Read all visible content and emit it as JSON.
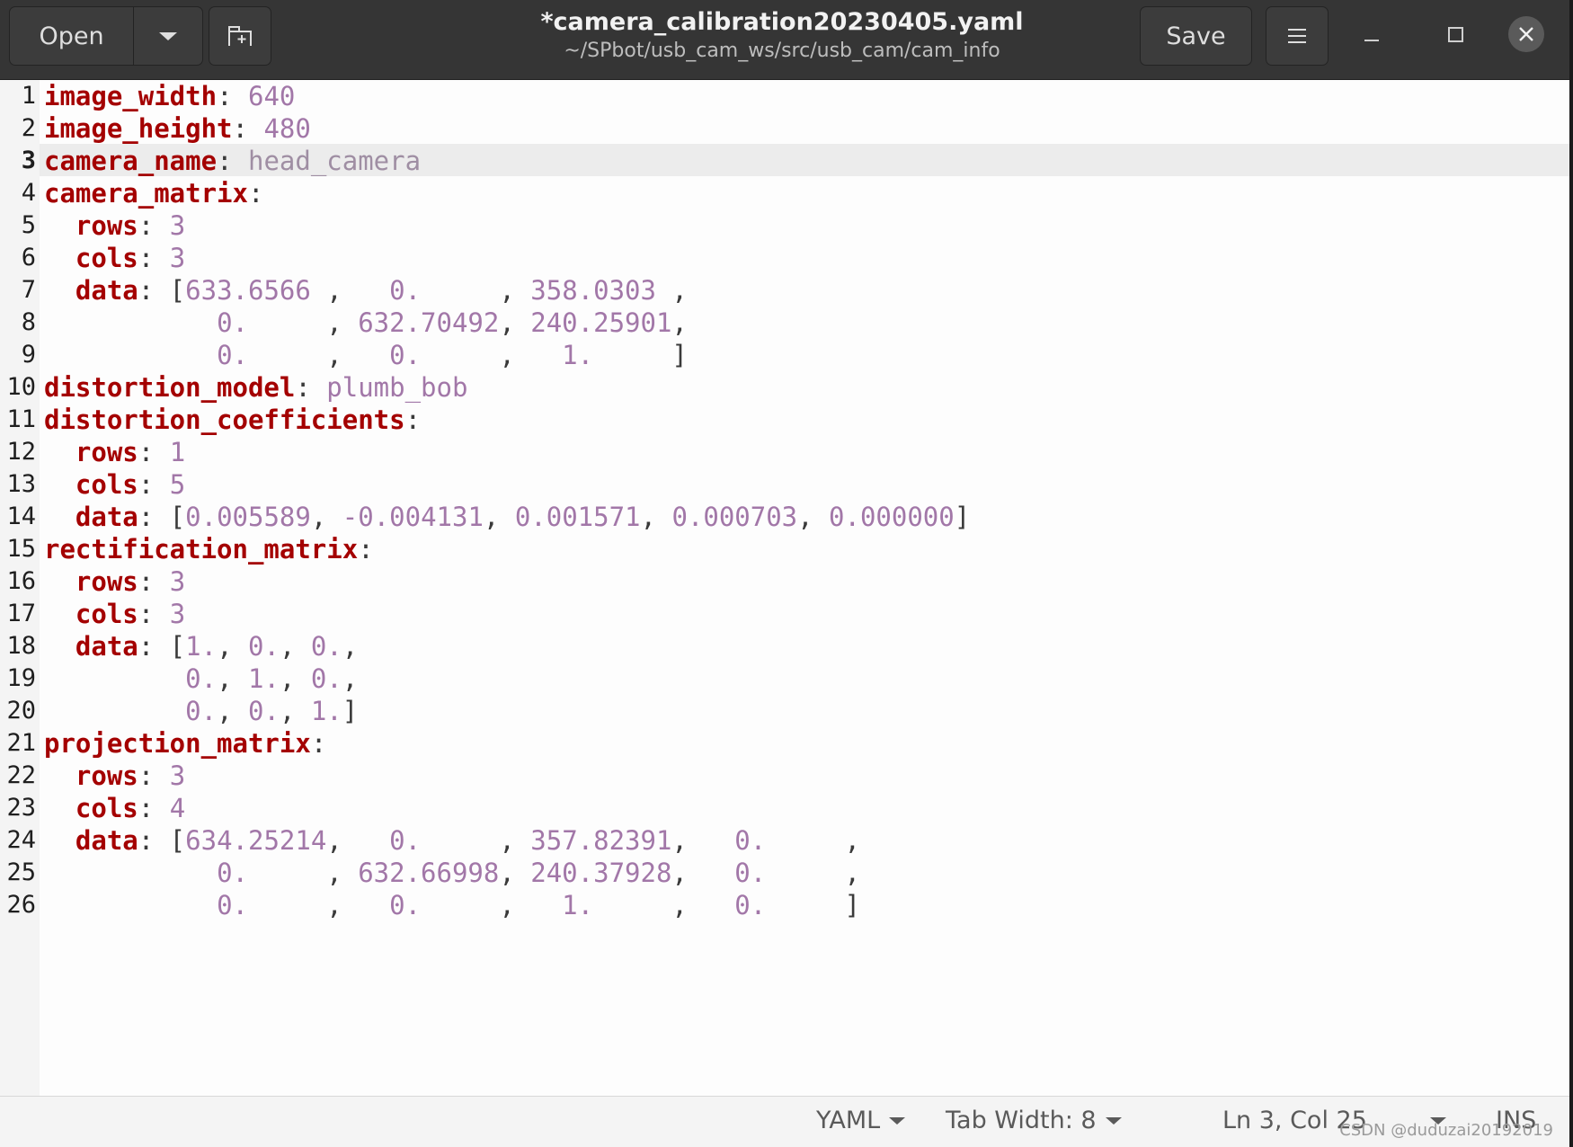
{
  "header": {
    "open_label": "Open",
    "save_label": "Save",
    "title": "*camera_calibration20230405.yaml",
    "subtitle": "~/SPbot/usb_cam_ws/src/usb_cam/cam_info"
  },
  "editor": {
    "current_line": 3,
    "lines": [
      [
        [
          "k",
          "image_width"
        ],
        [
          "p",
          ": "
        ],
        [
          "v",
          "640"
        ]
      ],
      [
        [
          "k",
          "image_height"
        ],
        [
          "p",
          ": "
        ],
        [
          "v",
          "480"
        ]
      ],
      [
        [
          "k",
          "camera_name"
        ],
        [
          "p",
          ": "
        ],
        [
          "vcur",
          "head_camera"
        ]
      ],
      [
        [
          "k",
          "camera_matrix"
        ],
        [
          "p",
          ":"
        ]
      ],
      [
        [
          "p",
          "  "
        ],
        [
          "k",
          "rows"
        ],
        [
          "p",
          ": "
        ],
        [
          "v",
          "3"
        ]
      ],
      [
        [
          "p",
          "  "
        ],
        [
          "k",
          "cols"
        ],
        [
          "p",
          ": "
        ],
        [
          "v",
          "3"
        ]
      ],
      [
        [
          "p",
          "  "
        ],
        [
          "k",
          "data"
        ],
        [
          "p",
          ": ["
        ],
        [
          "v",
          "633.6566 "
        ],
        [
          "p",
          ", "
        ],
        [
          "v",
          "  0.     "
        ],
        [
          "p",
          ", "
        ],
        [
          "v",
          "358.0303 "
        ],
        [
          "p",
          ","
        ]
      ],
      [
        [
          "p",
          "           "
        ],
        [
          "v",
          "0.     "
        ],
        [
          "p",
          ", "
        ],
        [
          "v",
          "632.70492"
        ],
        [
          "p",
          ", "
        ],
        [
          "v",
          "240.25901"
        ],
        [
          "p",
          ","
        ]
      ],
      [
        [
          "p",
          "           "
        ],
        [
          "v",
          "0.     "
        ],
        [
          "p",
          ", "
        ],
        [
          "v",
          "  0.     "
        ],
        [
          "p",
          ", "
        ],
        [
          "v",
          "  1.     "
        ],
        [
          "p",
          "]"
        ]
      ],
      [
        [
          "k",
          "distortion_model"
        ],
        [
          "p",
          ": "
        ],
        [
          "v",
          "plumb_bob"
        ]
      ],
      [
        [
          "k",
          "distortion_coefficients"
        ],
        [
          "p",
          ":"
        ]
      ],
      [
        [
          "p",
          "  "
        ],
        [
          "k",
          "rows"
        ],
        [
          "p",
          ": "
        ],
        [
          "v",
          "1"
        ]
      ],
      [
        [
          "p",
          "  "
        ],
        [
          "k",
          "cols"
        ],
        [
          "p",
          ": "
        ],
        [
          "v",
          "5"
        ]
      ],
      [
        [
          "p",
          "  "
        ],
        [
          "k",
          "data"
        ],
        [
          "p",
          ": ["
        ],
        [
          "v",
          "0.005589"
        ],
        [
          "p",
          ", "
        ],
        [
          "v",
          "-0.004131"
        ],
        [
          "p",
          ", "
        ],
        [
          "v",
          "0.001571"
        ],
        [
          "p",
          ", "
        ],
        [
          "v",
          "0.000703"
        ],
        [
          "p",
          ", "
        ],
        [
          "v",
          "0.000000"
        ],
        [
          "p",
          "]"
        ]
      ],
      [
        [
          "k",
          "rectification_matrix"
        ],
        [
          "p",
          ":"
        ]
      ],
      [
        [
          "p",
          "  "
        ],
        [
          "k",
          "rows"
        ],
        [
          "p",
          ": "
        ],
        [
          "v",
          "3"
        ]
      ],
      [
        [
          "p",
          "  "
        ],
        [
          "k",
          "cols"
        ],
        [
          "p",
          ": "
        ],
        [
          "v",
          "3"
        ]
      ],
      [
        [
          "p",
          "  "
        ],
        [
          "k",
          "data"
        ],
        [
          "p",
          ": ["
        ],
        [
          "v",
          "1."
        ],
        [
          "p",
          ", "
        ],
        [
          "v",
          "0."
        ],
        [
          "p",
          ", "
        ],
        [
          "v",
          "0."
        ],
        [
          "p",
          ","
        ]
      ],
      [
        [
          "p",
          "         "
        ],
        [
          "v",
          "0."
        ],
        [
          "p",
          ", "
        ],
        [
          "v",
          "1."
        ],
        [
          "p",
          ", "
        ],
        [
          "v",
          "0."
        ],
        [
          "p",
          ","
        ]
      ],
      [
        [
          "p",
          "         "
        ],
        [
          "v",
          "0."
        ],
        [
          "p",
          ", "
        ],
        [
          "v",
          "0."
        ],
        [
          "p",
          ", "
        ],
        [
          "v",
          "1."
        ],
        [
          "p",
          "]"
        ]
      ],
      [
        [
          "k",
          "projection_matrix"
        ],
        [
          "p",
          ":"
        ]
      ],
      [
        [
          "p",
          "  "
        ],
        [
          "k",
          "rows"
        ],
        [
          "p",
          ": "
        ],
        [
          "v",
          "3"
        ]
      ],
      [
        [
          "p",
          "  "
        ],
        [
          "k",
          "cols"
        ],
        [
          "p",
          ": "
        ],
        [
          "v",
          "4"
        ]
      ],
      [
        [
          "p",
          "  "
        ],
        [
          "k",
          "data"
        ],
        [
          "p",
          ": ["
        ],
        [
          "v",
          "634.25214"
        ],
        [
          "p",
          ", "
        ],
        [
          "v",
          "  0.     "
        ],
        [
          "p",
          ", "
        ],
        [
          "v",
          "357.82391"
        ],
        [
          "p",
          ", "
        ],
        [
          "v",
          "  0.     "
        ],
        [
          "p",
          ","
        ]
      ],
      [
        [
          "p",
          "           "
        ],
        [
          "v",
          "0.     "
        ],
        [
          "p",
          ", "
        ],
        [
          "v",
          "632.66998"
        ],
        [
          "p",
          ", "
        ],
        [
          "v",
          "240.37928"
        ],
        [
          "p",
          ", "
        ],
        [
          "v",
          "  0.     "
        ],
        [
          "p",
          ","
        ]
      ],
      [
        [
          "p",
          "           "
        ],
        [
          "v",
          "0.     "
        ],
        [
          "p",
          ", "
        ],
        [
          "v",
          "  0.     "
        ],
        [
          "p",
          ", "
        ],
        [
          "v",
          "  1.     "
        ],
        [
          "p",
          ", "
        ],
        [
          "v",
          "  0.     "
        ],
        [
          "p",
          "]"
        ]
      ]
    ]
  },
  "statusbar": {
    "language": "YAML",
    "tab_width": "Tab Width: 8",
    "position": "Ln 3, Col 25",
    "mode": "INS"
  },
  "watermark": "CSDN @duduzai20192019",
  "colors": {
    "key": "#a40000",
    "value": "#a277a8",
    "header_bg": "#353535"
  }
}
